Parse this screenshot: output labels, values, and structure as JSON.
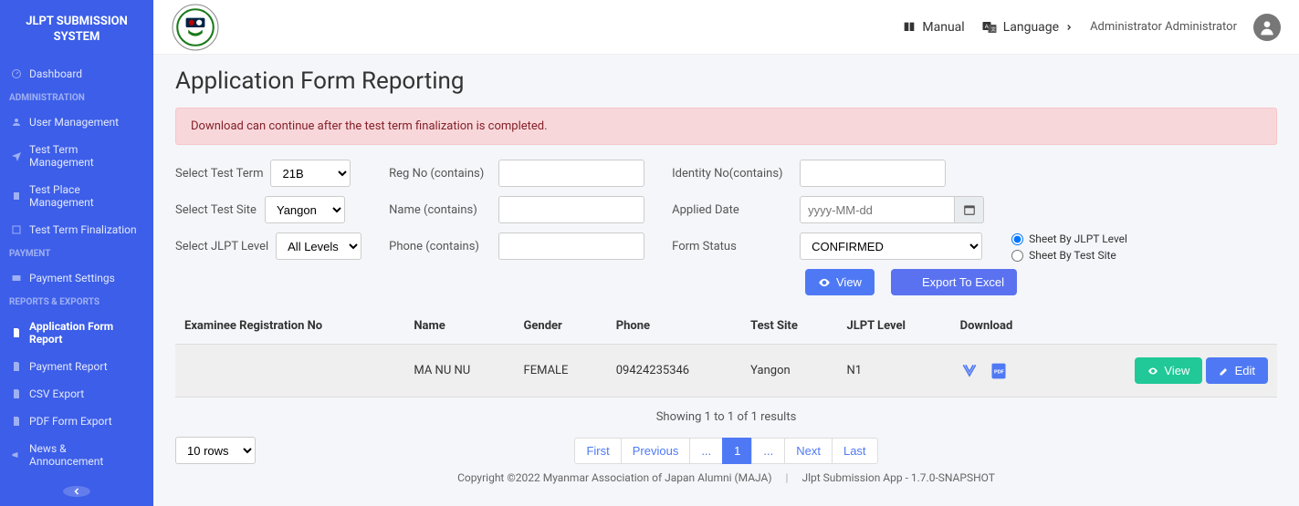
{
  "sidebar": {
    "title": "JLPT SUBMISSION SYSTEM",
    "items": [
      {
        "label": "Dashboard"
      }
    ],
    "sections": [
      {
        "header": "ADMINISTRATION",
        "items": [
          {
            "label": "User Management"
          },
          {
            "label": "Test Term Management"
          },
          {
            "label": "Test Place Management"
          },
          {
            "label": "Test Term Finalization"
          }
        ]
      },
      {
        "header": "PAYMENT",
        "items": [
          {
            "label": "Payment Settings"
          }
        ]
      },
      {
        "header": "REPORTS & EXPORTS",
        "items": [
          {
            "label": "Application Form Report",
            "active": true
          },
          {
            "label": "Payment Report"
          },
          {
            "label": "CSV Export"
          },
          {
            "label": "PDF Form Export"
          },
          {
            "label": "News & Announcement"
          }
        ]
      }
    ]
  },
  "topbar": {
    "manual": "Manual",
    "language": "Language",
    "user": "Administrator Administrator"
  },
  "page": {
    "title": "Application Form Reporting",
    "alert": "Download can continue after the test term finalization is completed."
  },
  "filters": {
    "test_term_label": "Select Test Term",
    "test_term_value": "21B",
    "test_site_label": "Select Test Site",
    "test_site_value": "Yangon",
    "jlpt_level_label": "Select JLPT Level",
    "jlpt_level_value": "All Levels",
    "reg_no_label": "Reg No (contains)",
    "name_label": "Name (contains)",
    "phone_label": "Phone (contains)",
    "identity_label": "Identity No(contains)",
    "applied_date_label": "Applied Date",
    "applied_date_placeholder": "yyyy-MM-dd",
    "form_status_label": "Form Status",
    "form_status_value": "CONFIRMED",
    "sheet_by_level": "Sheet By JLPT Level",
    "sheet_by_site": "Sheet By Test Site",
    "view_btn": "View",
    "export_btn": "Export To Excel"
  },
  "table": {
    "headers": {
      "reg": "Examinee Registration No",
      "name": "Name",
      "gender": "Gender",
      "phone": "Phone",
      "site": "Test Site",
      "level": "JLPT Level",
      "download": "Download"
    },
    "rows": [
      {
        "reg": "",
        "name": "MA NU NU",
        "gender": "FEMALE",
        "phone": "09424235346",
        "site": "Yangon",
        "level": "N1"
      }
    ],
    "view_btn": "View",
    "edit_btn": "Edit"
  },
  "pagination": {
    "results_text": "Showing 1 to 1 of 1 results",
    "rows_select": "10 rows",
    "first": "First",
    "prev": "Previous",
    "dots": "...",
    "current": "1",
    "next": "Next",
    "last": "Last"
  },
  "footer": {
    "copyright": "Copyright ©2022 Myanmar Association of Japan Alumni (MAJA)",
    "version": "Jlpt Submission App - 1.7.0-SNAPSHOT"
  }
}
